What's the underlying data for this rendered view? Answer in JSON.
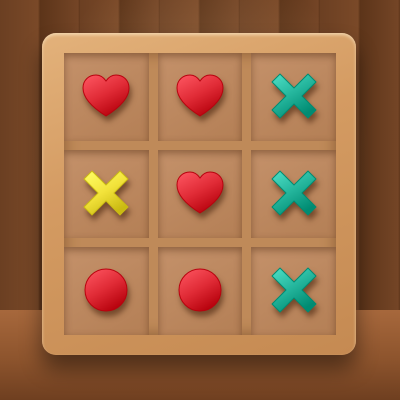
{
  "board": {
    "cells": [
      {
        "mark": "heart",
        "color": "#e02b36"
      },
      {
        "mark": "heart",
        "color": "#e02b36"
      },
      {
        "mark": "x",
        "color": "#22b39a"
      },
      {
        "mark": "x",
        "color": "#f2e23a"
      },
      {
        "mark": "heart",
        "color": "#e02b36"
      },
      {
        "mark": "x",
        "color": "#22b39a"
      },
      {
        "mark": "circle",
        "color": "#e02b36"
      },
      {
        "mark": "circle",
        "color": "#e02b36"
      },
      {
        "mark": "x",
        "color": "#22b39a"
      }
    ]
  }
}
